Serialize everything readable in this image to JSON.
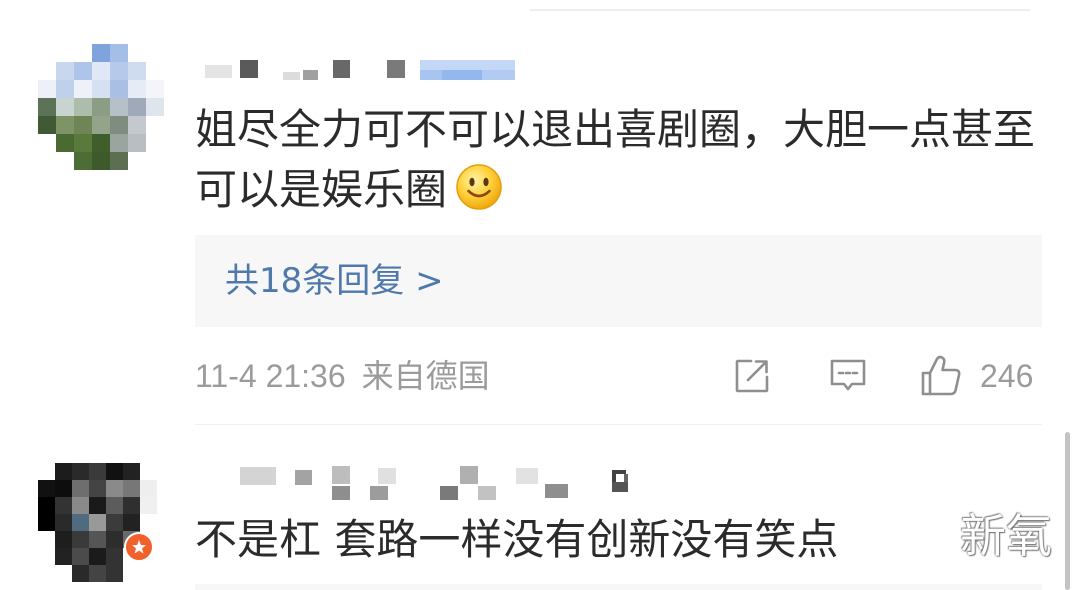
{
  "comments": [
    {
      "text": "姐尽全力可不可以退出喜剧圈，大胆一点甚至可以是娱乐圈",
      "emoji_icon": "smile-emoji-icon",
      "replies_label": "共18条回复 >",
      "timestamp": "11-4 21:36",
      "source": "来自德国",
      "like_count": "246"
    },
    {
      "text": "不是杠 套路一样没有创新没有笑点",
      "badge_icon": "star-badge-icon"
    }
  ],
  "actions": {
    "repost_icon": "repost-icon",
    "comment_icon": "comment-icon",
    "like_icon": "thumbs-up-icon"
  },
  "watermark": "新氧",
  "colors": {
    "text": "#2b2b2b",
    "link": "#4f78ac",
    "meta": "#9b9b9b",
    "reply_box_bg": "#f7f7f7",
    "icon": "#8f8f8f",
    "badge": "#f2612b"
  }
}
